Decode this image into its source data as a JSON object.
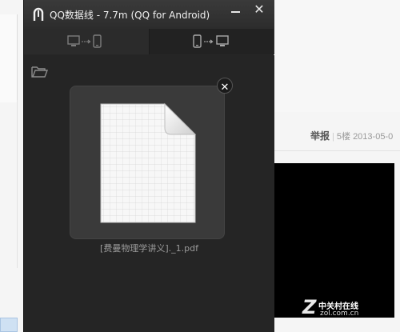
{
  "window": {
    "title": "QQ数据线 - 7.7m (QQ for Android)",
    "minimize_icon": "minimize-icon",
    "close_icon": "close-icon",
    "close_glyph": "✕"
  },
  "tabs": [
    {
      "icons": [
        "computer-icon",
        "arrow-icon",
        "phone-icon"
      ],
      "active": false
    },
    {
      "icons": [
        "phone-icon",
        "arrow-icon",
        "computer-icon"
      ],
      "active": true
    }
  ],
  "content": {
    "folder_icon": "folder-icon",
    "file": {
      "name": "[费曼物理学讲义]._1.pdf",
      "icon": "document-icon",
      "remove_glyph": "✕"
    }
  },
  "background_page": {
    "report_label": "举报",
    "floor": "5楼",
    "date": "2013-05-0",
    "watermark_logo": "Z",
    "watermark_text": "中关村在线",
    "watermark_url": "zol.com.cn"
  },
  "colors": {
    "window_bg": "#262626",
    "titlebar": "#333333",
    "card_bg": "#3a3a3a",
    "text_light": "#f0f0f0",
    "file_name_text": "#9a9a9a"
  }
}
